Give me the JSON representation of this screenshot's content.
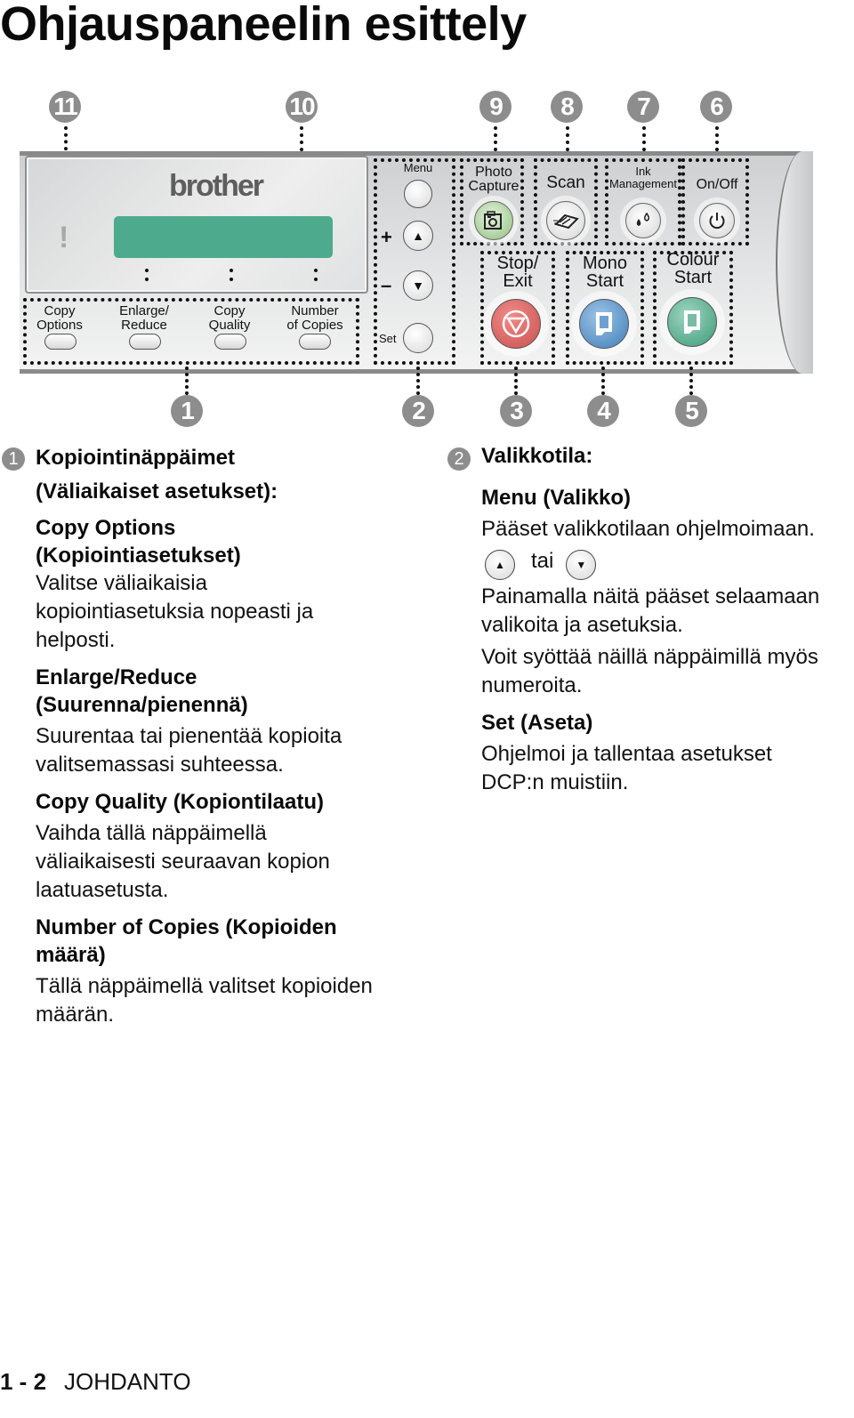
{
  "page": {
    "title": "Ohjauspaneelin esittely",
    "footer": {
      "page_number": "1 - 2",
      "section": "JOHDANTO"
    }
  },
  "panel": {
    "brand": "brother",
    "callouts": {
      "c1": "1",
      "c2": "2",
      "c3": "3",
      "c4": "4",
      "c5": "5",
      "c6": "6",
      "c7": "7",
      "c8": "8",
      "c9": "9",
      "c10": "10",
      "c11": "11"
    },
    "warning_icon": "!",
    "copy_keys": [
      {
        "line1": "Copy",
        "line2": "Options"
      },
      {
        "line1": "Enlarge/",
        "line2": "Reduce"
      },
      {
        "line1": "Copy",
        "line2": "Quality"
      },
      {
        "line1": "Number",
        "line2": "of Copies"
      }
    ],
    "menu_keys": {
      "menu": "Menu",
      "plus": "+",
      "minus": "–",
      "up": "▲",
      "down": "▼",
      "set": "Set"
    },
    "function_keys": [
      {
        "line1": "Photo",
        "line2": "Capture",
        "icon": "camera-icon"
      },
      {
        "line1": "",
        "line2": "Scan",
        "icon": "scanner-icon"
      },
      {
        "line1": "Ink",
        "line2": "Management",
        "icon": "ink-drops-icon"
      },
      {
        "line1": "",
        "line2": "On/Off",
        "icon": "power-icon"
      }
    ],
    "start_keys": [
      {
        "line1": "Stop/",
        "line2": "Exit",
        "color": "#c8504f",
        "icon": "stop-icon"
      },
      {
        "line1": "Mono",
        "line2": "Start",
        "color": "#3f7fb8",
        "icon": "document-icon"
      },
      {
        "line1": "Colour",
        "line2": "Start",
        "color": "#3d9a78",
        "icon": "document-icon"
      }
    ],
    "lcd_color": "#4eaa8c"
  },
  "left_column": {
    "number": "1",
    "heading_line1": "Kopiointinäppäimet",
    "heading_line2": "(Väliaikaiset asetukset):",
    "items": [
      {
        "title_line1": "Copy Options",
        "title_line2": "(Kopiointiasetukset)",
        "desc": [
          "Valitse väliaikaisia",
          "kopiointiasetuksia nopeasti ja",
          "helposti."
        ]
      },
      {
        "title_line1": "Enlarge/Reduce",
        "title_line2": "(Suurenna/pienennä)",
        "desc": [
          "Suurentaa tai pienentää kopioita",
          "valitsemassasi suhteessa."
        ]
      },
      {
        "title_line1": "Copy Quality (Kopiontilaatu)",
        "title_line2": "",
        "desc": [
          "Vaihda tällä näppäimellä",
          "väliaikaisesti seuraavan kopion",
          "laatuasetusta."
        ]
      },
      {
        "title_line1": "Number of Copies (Kopioiden",
        "title_line2": "määrä)",
        "desc": [
          "Tällä näppäimellä valitset kopioiden",
          "määrän."
        ]
      }
    ]
  },
  "right_column": {
    "number": "2",
    "heading": "Valikkotila:",
    "menu_title": "Menu (Valikko)",
    "menu_desc": "Pääset valikkotilaan ohjelmoimaan.",
    "arrows": {
      "up": "▲",
      "or": "tai",
      "down": "▼"
    },
    "arrows_desc": [
      "Painamalla näitä pääset selaamaan",
      "valikoita ja asetuksia."
    ],
    "arrows_desc2": [
      "Voit syöttää näillä näppäimillä myös",
      "numeroita."
    ],
    "set_title": "Set (Aseta)",
    "set_desc": [
      "Ohjelmoi ja tallentaa asetukset",
      "DCP:n muistiin."
    ]
  }
}
